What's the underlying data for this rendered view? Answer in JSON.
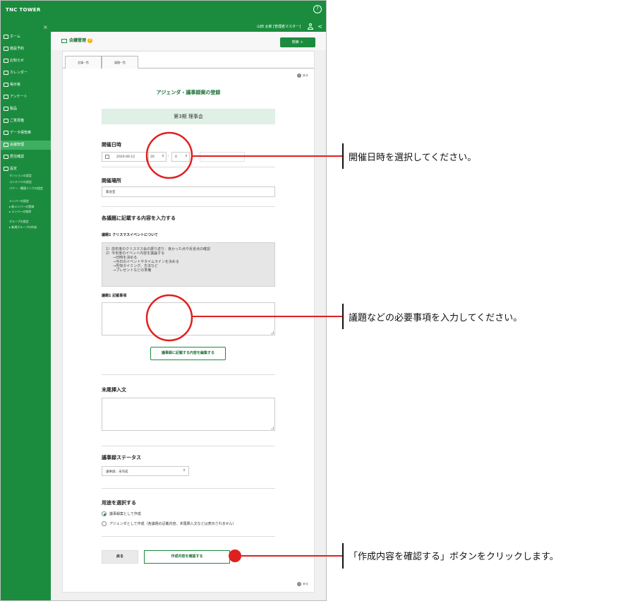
{
  "app": {
    "brand": "TNC TOWER",
    "user_name": "山田 太郎 [管理者マスター]"
  },
  "sidebar": {
    "items": [
      {
        "label": "ホーム"
      },
      {
        "label": "施設予約"
      },
      {
        "label": "お知らせ"
      },
      {
        "label": "カレンダー"
      },
      {
        "label": "掲示板"
      },
      {
        "label": "アンケート"
      },
      {
        "label": "製品"
      },
      {
        "label": "ご意見箱"
      },
      {
        "label": "データ保管庫"
      },
      {
        "label": "会議管理"
      },
      {
        "label": "居住確認"
      },
      {
        "label": "設定"
      }
    ],
    "settings_sub": [
      "マンションの設定",
      "コンテンツの設定",
      "バナー・関連リンクの設定",
      "メンバーの設定",
      "▸ 新メンバーの登録",
      "▸ メンバーの削除",
      "グループの設定",
      "▸ 新規グループの作成"
    ]
  },
  "header": {
    "page_title": "会議管理",
    "search_button": "検索 ＋"
  },
  "tabs": [
    {
      "label": "会議一覧"
    },
    {
      "label": "議題一覧"
    }
  ],
  "form": {
    "back_label": "戻る",
    "title": "アジェンダ・議事録案の登録",
    "meeting_name": "第3期 理事会",
    "datetime": {
      "label": "開催日時",
      "date": "2020-06-12",
      "hour": "20",
      "minute": "0"
    },
    "place": {
      "label": "開催場所",
      "value": "集会室"
    },
    "section_heading": "各議題に記載する内容を入力する",
    "agenda": {
      "label": "議題1 クリスマスイベントについて",
      "lines": [
        "1）前年度のクリスマス会の振り返り：良かった点や反省点の確認",
        "2）今年度のイベント内容を議論する",
        "　　→日時を決める",
        "　　→当日のイベントやタイムラインを決める",
        "　　→告知タイミング、方法など",
        "　　→プレゼントなどの準備"
      ],
      "notes_label": "議題1 記載事項",
      "notes_value": ""
    },
    "edit_button": "議事録に記載する内容を編集する",
    "footer_text": {
      "label": "末尾挿入文",
      "value": ""
    },
    "status": {
      "label": "議事録ステータス",
      "selected": "議事録：未作成"
    },
    "usage": {
      "label": "用途を選択する",
      "options": [
        "議事録案として作成",
        "アジェンダとして作成（各議題の記載内容、末尾挿入文などは表示されません）"
      ],
      "selected_index": 0
    },
    "back_button": "戻る",
    "confirm_button": "作成内容を確認する"
  },
  "callouts": [
    {
      "text": "開催日時を選択してください。"
    },
    {
      "text": "議題などの必要事項を入力してください。"
    },
    {
      "text": "「作成内容を確認する」ボタンをクリックします。"
    }
  ],
  "colors": {
    "brand_green": "#1b8c3e",
    "annotation_red": "#e0201f"
  }
}
